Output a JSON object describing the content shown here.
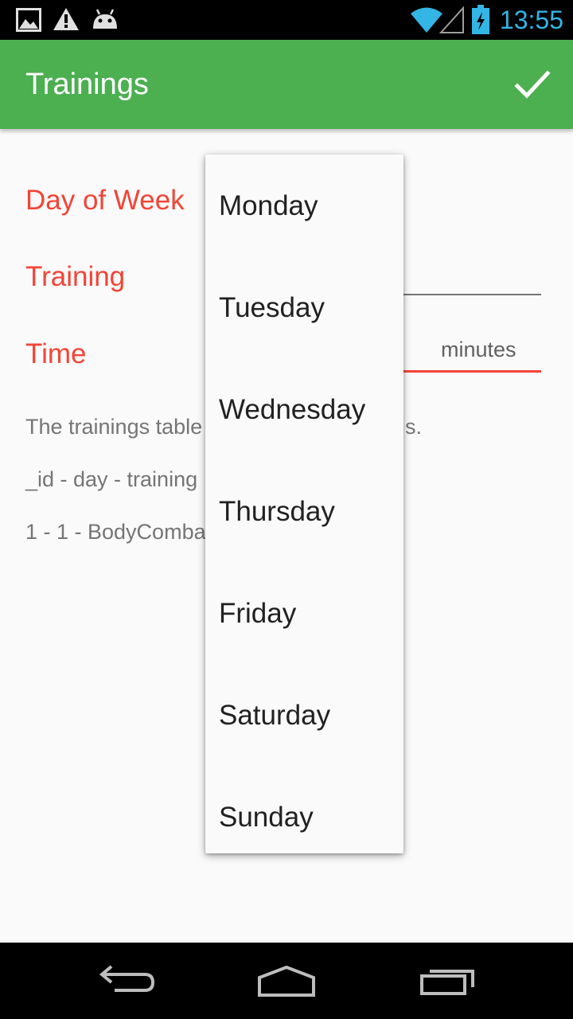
{
  "status_bar": {
    "time": "13:55",
    "icons": [
      "gallery-notification-icon",
      "warning-notification-icon",
      "android-notification-icon",
      "wifi-icon",
      "signal-icon",
      "battery-charging-icon"
    ],
    "accent_color": "#33b5e5"
  },
  "app_bar": {
    "title": "Trainings",
    "confirm_icon": "check-icon",
    "color": "#4caf50"
  },
  "form": {
    "day_label": "Day of Week",
    "training_label": "Training",
    "time_label": "Time",
    "time_unit": "minutes",
    "label_color": "#f44336"
  },
  "description": {
    "line1_left": "The trainings table",
    "line1_right": "s.",
    "line2": "_id - day - training",
    "line3": "1 - 1 - BodyComba"
  },
  "dropdown": {
    "options": [
      "Monday",
      "Tuesday",
      "Wednesday",
      "Thursday",
      "Friday",
      "Saturday",
      "Sunday"
    ]
  },
  "nav_bar": {
    "buttons": [
      "back-icon",
      "home-icon",
      "recents-icon"
    ]
  }
}
